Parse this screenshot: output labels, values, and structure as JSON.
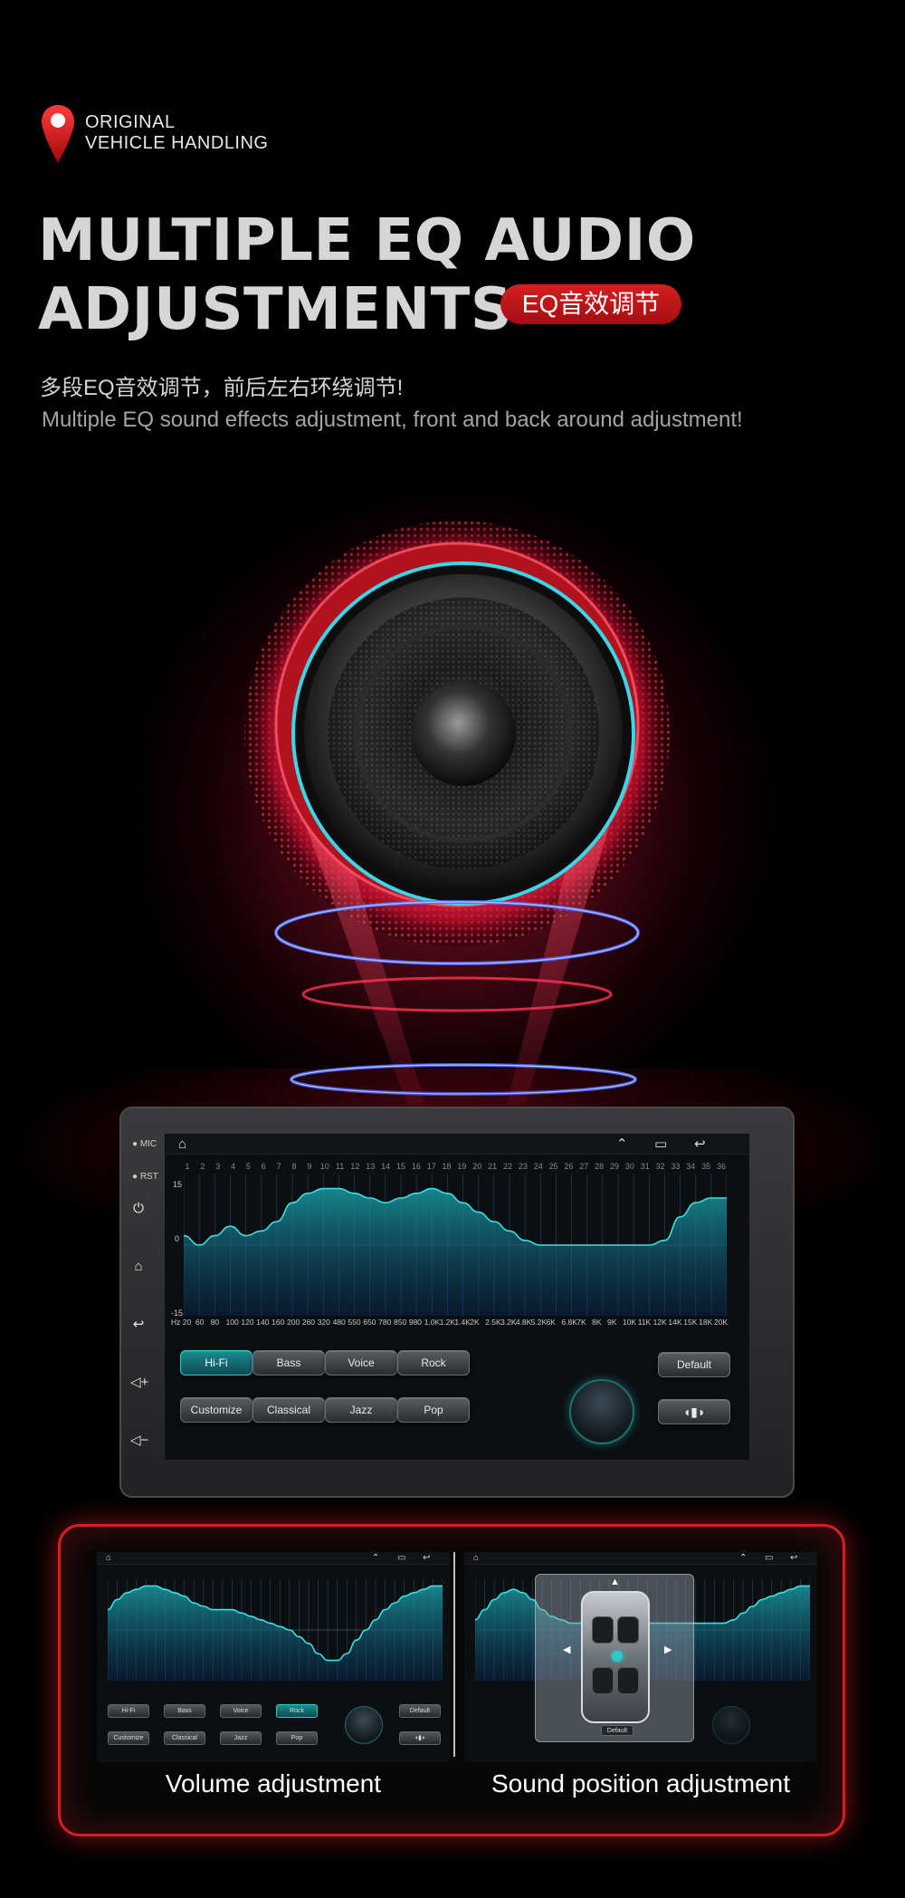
{
  "brand": {
    "line1": "ORIGINAL",
    "line2": "VEHICLE HANDLING"
  },
  "headline": {
    "line1": "MULTIPLE EQ AUDIO",
    "line2": "ADJUSTMENTS",
    "badge": "EQ音效调节"
  },
  "subtitle": {
    "cn": "多段EQ音效调节，前后左右环绕调节!",
    "en": "Multiple EQ sound effects adjustment, front and back around adjustment!"
  },
  "device": {
    "mic_label": "MIC",
    "rst_label": "RST",
    "side_icons": [
      "power-icon",
      "home-icon",
      "back-icon",
      "volume-up-icon",
      "volume-down-icon"
    ],
    "topbar_icons": [
      "home-outline-icon",
      "chevrons-up-icon",
      "recent-apps-icon",
      "return-icon"
    ]
  },
  "eq": {
    "bands": [
      "1",
      "2",
      "3",
      "4",
      "5",
      "6",
      "7",
      "8",
      "9",
      "10",
      "11",
      "12",
      "13",
      "14",
      "15",
      "16",
      "17",
      "18",
      "19",
      "20",
      "21",
      "22",
      "23",
      "24",
      "25",
      "26",
      "27",
      "28",
      "29",
      "30",
      "31",
      "32",
      "33",
      "34",
      "35",
      "36"
    ],
    "y_labels": {
      "top": "15",
      "mid": "0",
      "bottom": "-15"
    },
    "ylim": [
      -15,
      15
    ],
    "hz_labels": [
      "Hz 20",
      "60",
      "80",
      "100",
      "120",
      "140",
      "160",
      "200",
      "260",
      "320",
      "480",
      "550",
      "650",
      "780",
      "850",
      "980",
      "1.0K",
      "1.2K",
      "1.4K",
      "2K",
      "2.5K",
      "3.2K",
      "4.8K",
      "5.2K",
      "6K",
      "6.8K",
      "7K",
      "8K",
      "9K",
      "10K",
      "11K",
      "12K",
      "14K",
      "15K",
      "18K",
      "20K"
    ],
    "values": [
      2,
      0,
      2,
      4,
      2,
      3,
      5,
      9,
      11,
      12,
      12,
      11,
      10,
      9,
      10,
      11,
      12,
      11,
      9,
      7,
      5,
      3,
      1,
      0,
      0,
      0,
      0,
      0,
      0,
      0,
      0,
      1,
      6,
      9,
      10,
      10
    ],
    "buttons_row1": [
      "Hi-Fi",
      "Bass",
      "Voice",
      "Rock"
    ],
    "buttons_row2": [
      "Customize",
      "Classical",
      "Jazz",
      "Pop"
    ],
    "default_label": "Default",
    "active_button": "Hi-Fi"
  },
  "mini_volume": {
    "values": [
      6,
      9,
      11,
      12,
      13,
      13,
      12,
      11,
      10,
      8,
      7,
      6,
      6,
      6,
      5,
      4,
      3,
      2,
      1,
      0,
      -2,
      -4,
      -7,
      -9,
      -9,
      -7,
      -3,
      0,
      3,
      6,
      8,
      10,
      11,
      12,
      13,
      13
    ],
    "active_button": "Rock",
    "buttons_row1": [
      "Hi-Fi",
      "Bass",
      "Voice",
      "Rock"
    ],
    "buttons_row2": [
      "Customize",
      "Classical",
      "Jazz",
      "Pop"
    ],
    "default_label": "Default"
  },
  "mini_position": {
    "values": [
      3,
      6,
      9,
      11,
      12,
      11,
      9,
      6,
      4,
      3,
      2,
      2,
      2,
      2,
      2,
      2,
      2,
      2,
      2,
      2,
      2,
      2,
      2,
      2,
      2,
      2,
      2,
      3,
      5,
      7,
      9,
      10,
      11,
      12,
      13,
      13
    ],
    "default_label": "Default"
  },
  "captions": {
    "left": "Volume adjustment",
    "right": "Sound position adjustment"
  },
  "colors": {
    "accent_red": "#d52020",
    "eq_teal": "#2ec8c8",
    "eq_fill": "#0f6b73"
  }
}
